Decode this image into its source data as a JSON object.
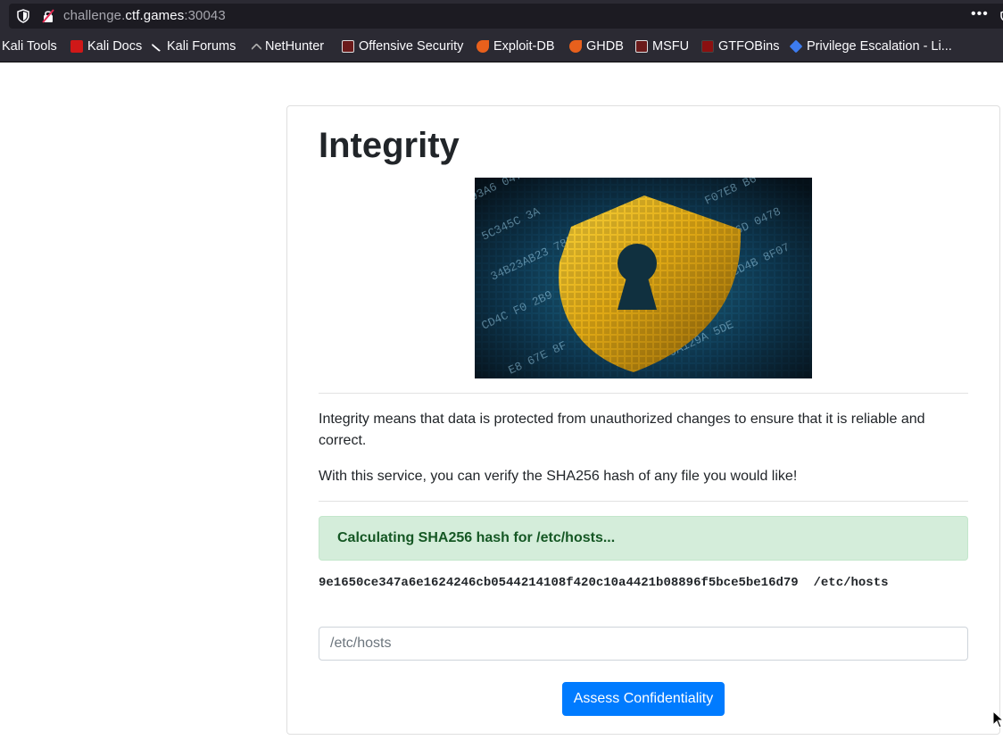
{
  "browser": {
    "url_prefix": "challenge.",
    "url_host": "ctf.games",
    "url_port": ":30043",
    "menu_dots": "•••"
  },
  "bookmarks": [
    {
      "label": "Kali Tools",
      "icon": "kali-icon"
    },
    {
      "label": "Kali Docs",
      "icon": "kali-docs-icon"
    },
    {
      "label": "Kali Forums",
      "icon": "kali-forums-icon"
    },
    {
      "label": "NetHunter",
      "icon": "nethunter-icon"
    },
    {
      "label": "Offensive Security",
      "icon": "offsec-icon"
    },
    {
      "label": "Exploit-DB",
      "icon": "exploitdb-icon"
    },
    {
      "label": "GHDB",
      "icon": "ghdb-icon"
    },
    {
      "label": "MSFU",
      "icon": "msfu-icon"
    },
    {
      "label": "GTFOBins",
      "icon": "gtfobins-icon"
    },
    {
      "label": "Privilege Escalation - Li...",
      "icon": "privesc-icon"
    }
  ],
  "page": {
    "title": "Integrity",
    "description": "Integrity means that data is protected from unauthorized changes to ensure that it is reliable and correct.",
    "service_text": "With this service, you can verify the SHA256 hash of any file you would like!",
    "alert": "Calculating SHA256 hash for /etc/hosts...",
    "hash_output": "9e1650ce347a6e1624246cb0544214108f420c10a4421b08896f5bce5be16d79  /etc/hosts",
    "input_placeholder": "/etc/hosts",
    "button_label": "Assess Confidentiality"
  },
  "colors": {
    "accent": "#007bff",
    "alert_bg": "#d4edda",
    "alert_text": "#155724"
  }
}
